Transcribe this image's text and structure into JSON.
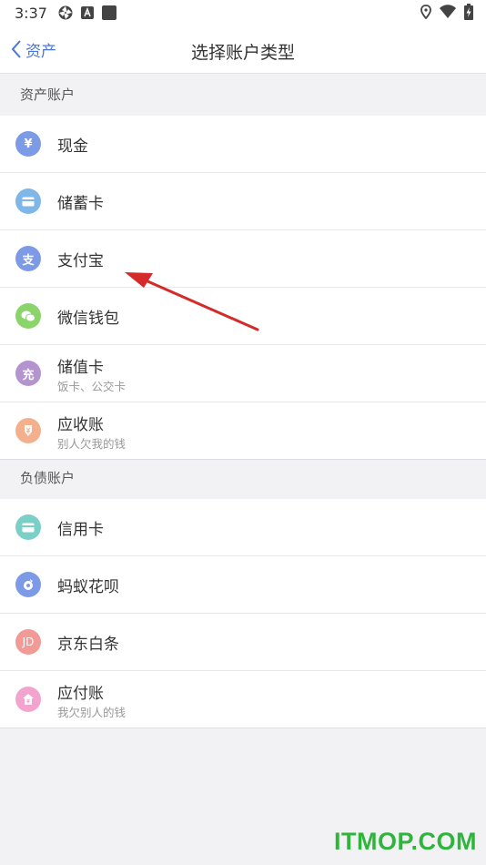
{
  "status_bar": {
    "time": "3:37",
    "left_icons": [
      "aperture-icon",
      "text-a-icon",
      "square-app-icon"
    ],
    "right_icons": [
      "location-icon",
      "wifi-icon",
      "battery-charging-icon"
    ]
  },
  "nav": {
    "back_label": "资产",
    "title": "选择账户类型"
  },
  "sections": [
    {
      "header": "资产账户",
      "items": [
        {
          "title": "现金",
          "icon": "yen-icon",
          "glyph": "¥",
          "color": "#7d9ae6"
        },
        {
          "title": "储蓄卡",
          "icon": "card-icon",
          "glyph": "",
          "color": "#7fb8e8"
        },
        {
          "title": "支付宝",
          "icon": "alipay-icon",
          "glyph": "支",
          "color": "#7d9ae6"
        },
        {
          "title": "微信钱包",
          "icon": "wechat-icon",
          "glyph": "",
          "color": "#8bd46b"
        },
        {
          "title": "储值卡",
          "subtitle": "饭卡、公交卡",
          "icon": "recharge-icon",
          "glyph": "充",
          "color": "#b394cf"
        },
        {
          "title": "应收账",
          "subtitle": "别人欠我的钱",
          "icon": "receivable-icon",
          "glyph": "",
          "color": "#f4b08c"
        }
      ]
    },
    {
      "header": "负债账户",
      "items": [
        {
          "title": "信用卡",
          "icon": "credit-card-icon",
          "glyph": "",
          "color": "#7ad0c9"
        },
        {
          "title": "蚂蚁花呗",
          "icon": "huabei-icon",
          "glyph": "",
          "color": "#7d9ae6"
        },
        {
          "title": "京东白条",
          "icon": "jd-icon",
          "glyph": "JD",
          "color": "#f29a96"
        },
        {
          "title": "应付账",
          "subtitle": "我欠别人的钱",
          "icon": "payable-icon",
          "glyph": "",
          "color": "#f2a4cf"
        }
      ]
    }
  ],
  "watermark": "ITMOP.COM",
  "colors": {
    "accent": "#4a76d9",
    "arrow": "#d42a2a",
    "watermark": "#2fb53c"
  }
}
